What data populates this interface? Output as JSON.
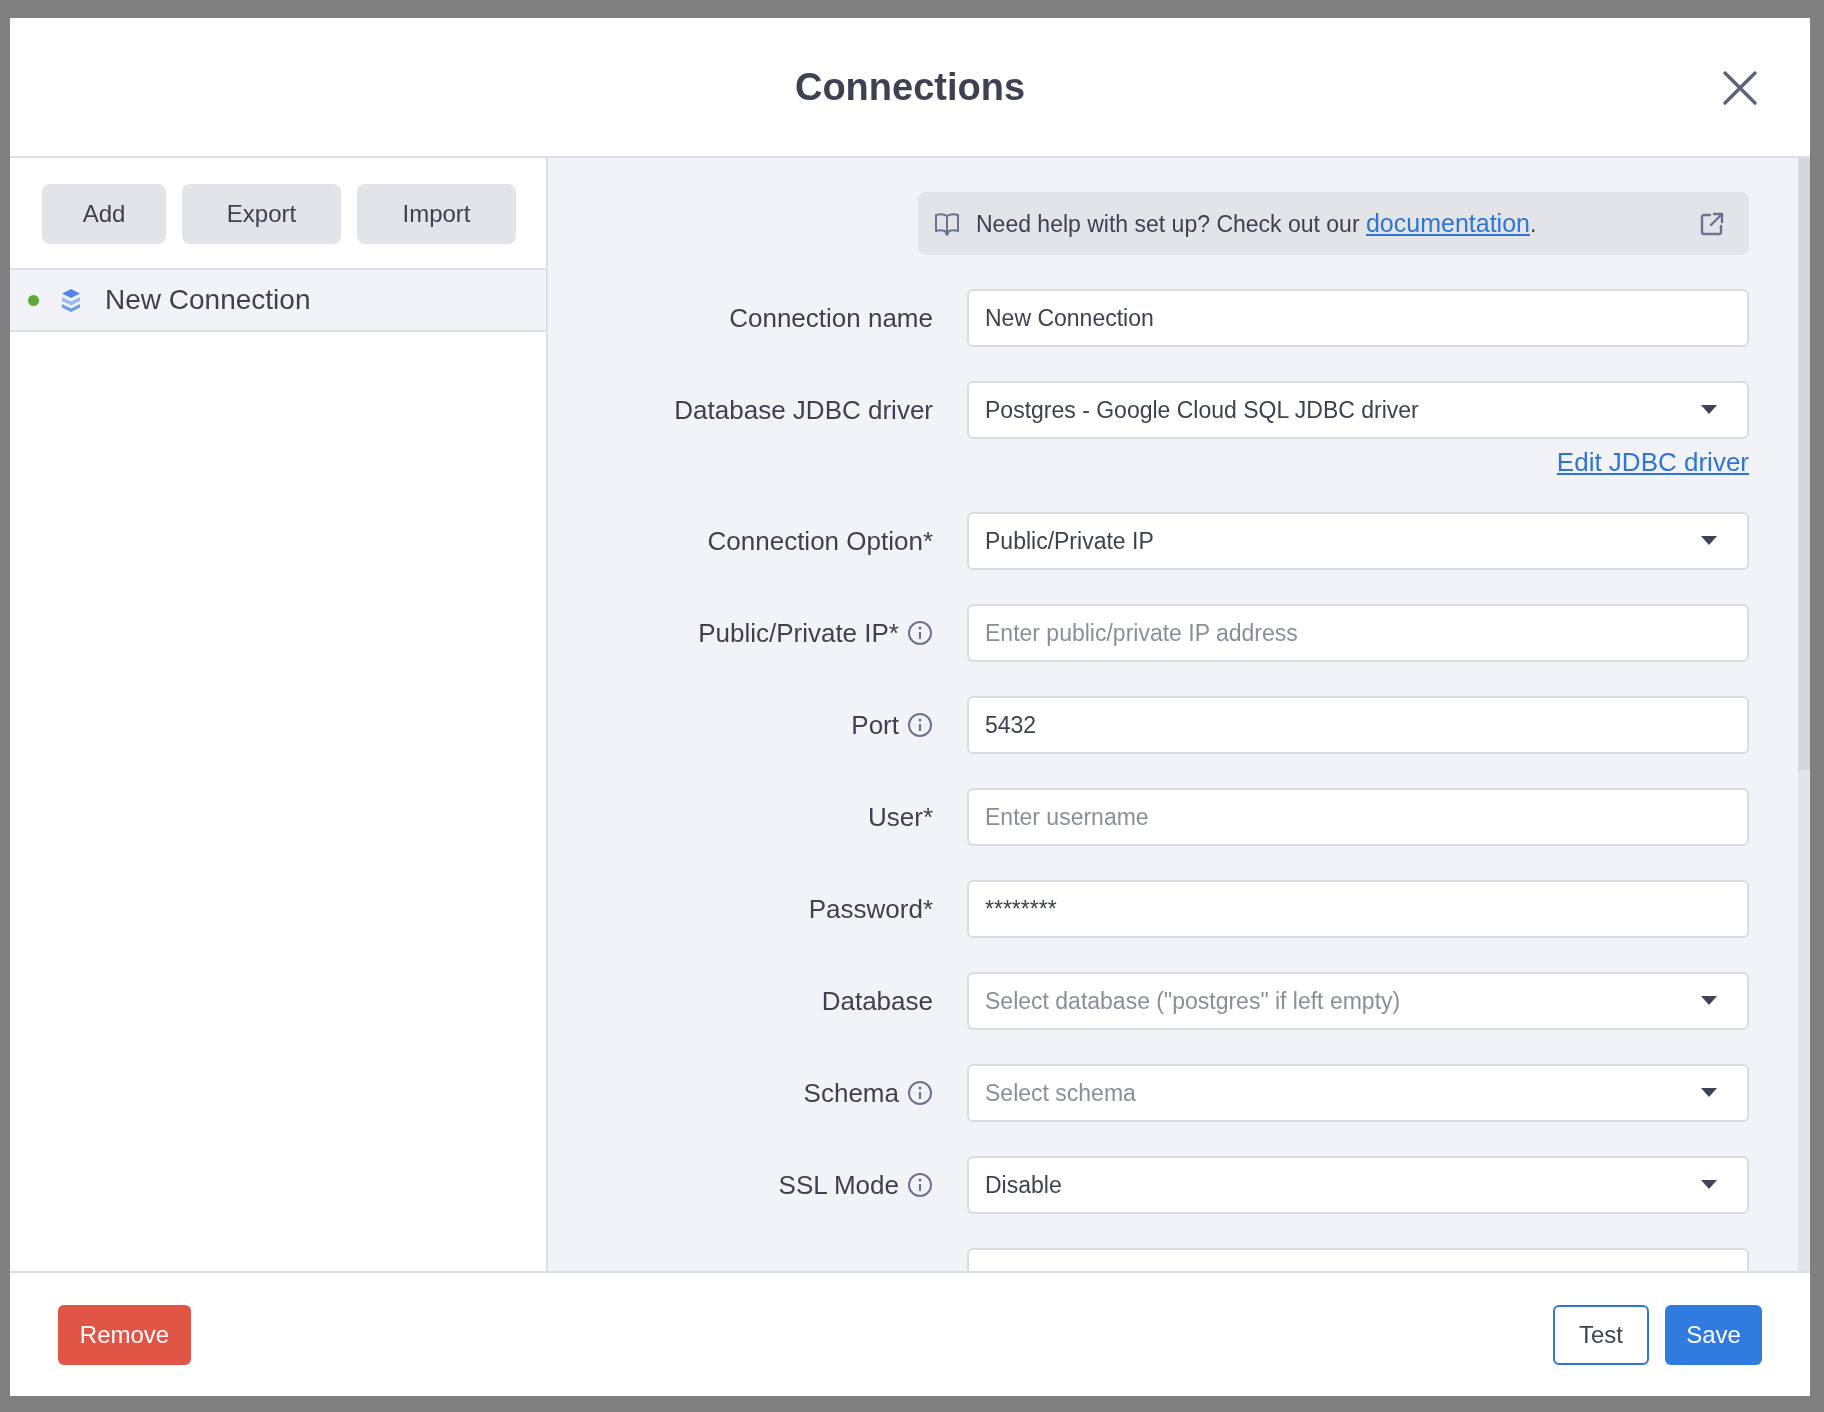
{
  "dialog": {
    "title": "Connections"
  },
  "toolbar": [
    "Add",
    "Export",
    "Import"
  ],
  "connections": [
    {
      "name": "New Connection",
      "selected": true,
      "color": "#5fa83c"
    }
  ],
  "help": {
    "text": "Need help with set up? Check out our ",
    "link": "documentation",
    "suffix": "."
  },
  "fields": [
    {
      "kind": "text",
      "label": "Connection name",
      "info": false,
      "value": "New Connection"
    },
    {
      "kind": "select",
      "label": "Database JDBC driver",
      "info": false,
      "value": "Postgres - Google Cloud SQL JDBC driver",
      "link": "Edit JDBC driver"
    },
    {
      "kind": "select",
      "label": "Connection Option*",
      "info": false,
      "value": "Public/Private IP"
    },
    {
      "kind": "text",
      "label": "Public/Private IP*",
      "info": true,
      "placeholder": "Enter public/private IP address"
    },
    {
      "kind": "text",
      "label": "Port",
      "info": true,
      "value": "5432"
    },
    {
      "kind": "text",
      "label": "User*",
      "info": false,
      "placeholder": "Enter username"
    },
    {
      "kind": "text",
      "label": "Password*",
      "info": false,
      "value": "********"
    },
    {
      "kind": "select",
      "label": "Database",
      "info": false,
      "placeholder": "Select database (\"postgres\" if left empty)"
    },
    {
      "kind": "select",
      "label": "Schema",
      "info": true,
      "placeholder": "Select schema"
    },
    {
      "kind": "select",
      "label": "SSL Mode",
      "info": true,
      "value": "Disable"
    },
    {
      "kind": "text",
      "info": false
    }
  ],
  "footer": {
    "remove": "Remove",
    "test": "Test",
    "save": "Save"
  }
}
